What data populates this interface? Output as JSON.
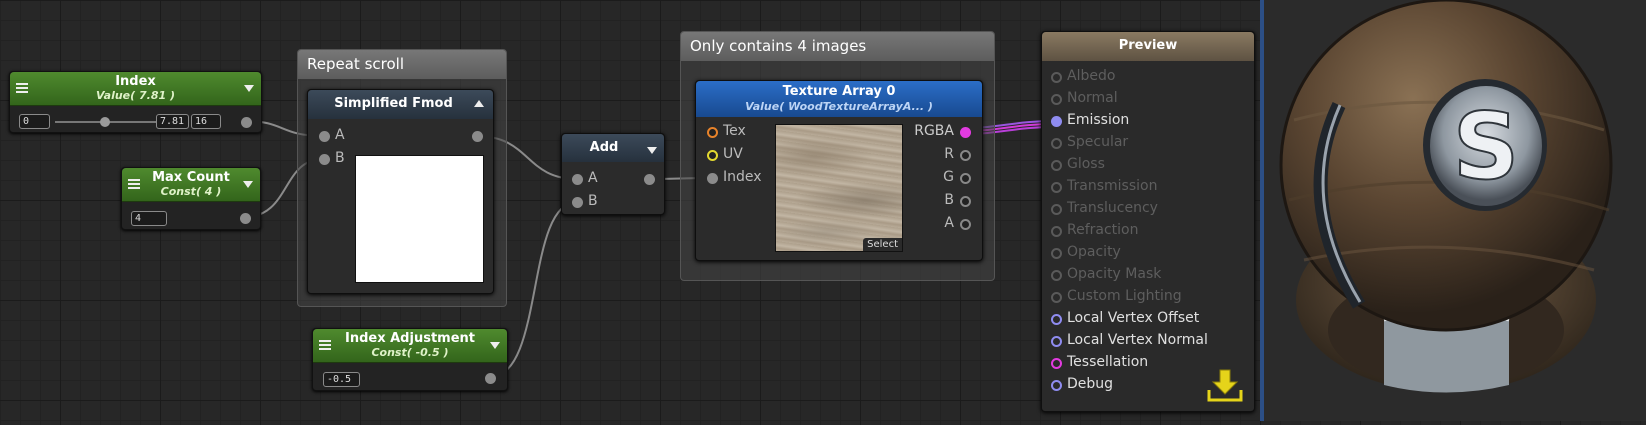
{
  "nodes": {
    "index": {
      "title": "Index",
      "subtitle": "Value( 7.81 )",
      "min": "0",
      "value": "7.81",
      "max": "16",
      "slider_fraction": 0.49
    },
    "max_count": {
      "title": "Max Count",
      "subtitle": "Const( 4 )",
      "value": "4"
    },
    "index_adjustment": {
      "title": "Index Adjustment",
      "subtitle": "Const( -0.5 )",
      "value": "-0.5"
    },
    "add": {
      "title": "Add",
      "input_a": "A",
      "input_b": "B"
    },
    "simplified_fmod": {
      "title": "Simplified Fmod",
      "input_a": "A",
      "input_b": "B"
    },
    "texture_array": {
      "title": "Texture Array 0",
      "subtitle": "Value( WoodTextureArrayA... )",
      "inputs": [
        "Tex",
        "UV",
        "Index"
      ],
      "outputs": [
        "RGBA",
        "R",
        "G",
        "B",
        "A"
      ],
      "select_label": "Select"
    }
  },
  "groups": {
    "repeat_scroll": "Repeat scroll",
    "only_contains": "Only contains 4 images"
  },
  "preview": {
    "title": "Preview",
    "inputs": [
      {
        "label": "Albedo",
        "active": false,
        "color": "#5a5a5a"
      },
      {
        "label": "Normal",
        "active": false,
        "color": "#5a5a5a"
      },
      {
        "label": "Emission",
        "active": true,
        "connected": true,
        "color": "#8f8cf0"
      },
      {
        "label": "Specular",
        "active": false,
        "color": "#5a5a5a"
      },
      {
        "label": "Gloss",
        "active": false,
        "color": "#5a5a5a"
      },
      {
        "label": "Transmission",
        "active": false,
        "color": "#5a5a5a"
      },
      {
        "label": "Translucency",
        "active": false,
        "color": "#5a5a5a"
      },
      {
        "label": "Refraction",
        "active": false,
        "color": "#5a5a5a"
      },
      {
        "label": "Opacity",
        "active": false,
        "color": "#5a5a5a"
      },
      {
        "label": "Opacity Mask",
        "active": false,
        "color": "#5a5a5a"
      },
      {
        "label": "Custom Lighting",
        "active": false,
        "color": "#5a5a5a"
      },
      {
        "label": "Local Vertex Offset",
        "active": true,
        "color": "#8f8cf0"
      },
      {
        "label": "Local Vertex Normal",
        "active": true,
        "color": "#8f8cf0"
      },
      {
        "label": "Tessellation",
        "active": true,
        "color": "#e23be0"
      },
      {
        "label": "Debug",
        "active": true,
        "color": "#8f8cf0"
      }
    ],
    "download_icon": "download-tray-icon"
  },
  "viewport": {
    "logo_letter": "S"
  },
  "colors": {
    "green_header": "#3f7a24",
    "blue_header": "#1f5cae",
    "accent_magenta": "#e23be0",
    "accent_violet": "#8f8cf0"
  }
}
